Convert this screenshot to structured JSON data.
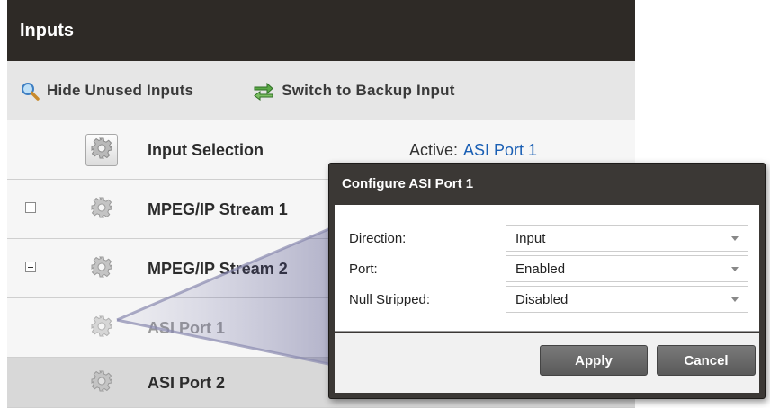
{
  "panel": {
    "title": "Inputs",
    "toolbar": {
      "hide_unused": "Hide Unused Inputs",
      "switch_backup": "Switch to Backup Input"
    },
    "input_selection": {
      "label": "Input Selection",
      "active_label": "Active:",
      "active_value": "ASI Port 1"
    },
    "rows": [
      {
        "label": "MPEG/IP Stream 1"
      },
      {
        "label": "MPEG/IP Stream 2"
      },
      {
        "label": "ASI Port 1"
      },
      {
        "label": "ASI Port 2"
      }
    ]
  },
  "dialog": {
    "title": "Configure ASI Port 1",
    "fields": [
      {
        "label": "Direction:",
        "value": "Input"
      },
      {
        "label": "Port:",
        "value": "Enabled"
      },
      {
        "label": "Null Stripped:",
        "value": "Disabled"
      }
    ],
    "apply_label": "Apply",
    "cancel_label": "Cancel"
  },
  "icons": {
    "search": "magnifier-icon",
    "switch": "switch-arrows-icon",
    "gear": "gear-icon",
    "expand": "plus-box-icon"
  },
  "colors": {
    "header_bg": "#2e2a26",
    "link": "#1a5fb4",
    "dialog_bg": "#3b3835"
  }
}
